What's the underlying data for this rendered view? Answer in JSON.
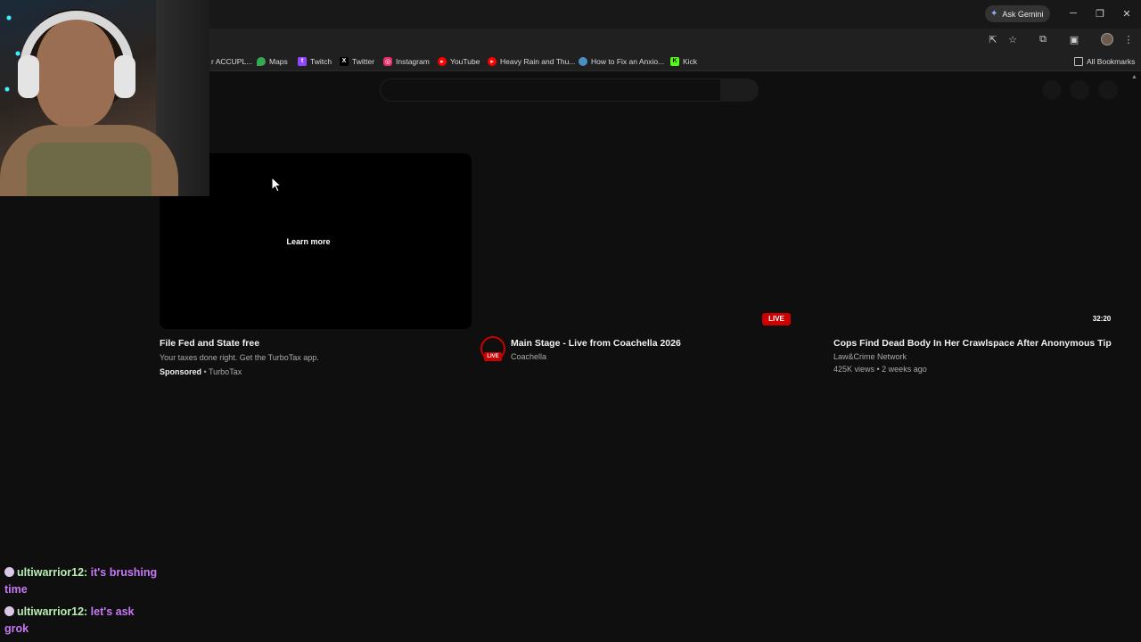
{
  "browser": {
    "ask_gemini": "Ask Gemini",
    "bookmarks": [
      {
        "label": "r ACCUPL...",
        "icon": "partial-icon",
        "color": "#202020"
      },
      {
        "label": "Maps",
        "icon": "maps-icon",
        "color": "#34a853"
      },
      {
        "label": "Twitch",
        "icon": "twitch-icon",
        "color": "#9146ff"
      },
      {
        "label": "Twitter",
        "icon": "x-icon",
        "color": "#000000"
      },
      {
        "label": "Instagram",
        "icon": "instagram-icon",
        "color": "#e1306c"
      },
      {
        "label": "YouTube",
        "icon": "youtube-icon",
        "color": "#ff0000"
      },
      {
        "label": "Heavy Rain and Thu...",
        "icon": "youtube-icon",
        "color": "#ff0000"
      },
      {
        "label": "How to Fix an Anxio...",
        "icon": "site-icon",
        "color": "#4a90c2"
      },
      {
        "label": "Kick",
        "icon": "kick-icon",
        "color": "#53fc18"
      }
    ],
    "all_bookmarks": "All Bookmarks"
  },
  "videos": [
    {
      "title": "File Fed and State free",
      "description": "Your taxes done right. Get the TurboTax app.",
      "sponsored": "Sponsored",
      "advertiser": "TurboTax",
      "overlay": "Learn more"
    },
    {
      "title": "Main Stage - Live from Coachella 2026",
      "channel": "Coachella",
      "badge": "LIVE",
      "avatar_badge": "LIVE"
    },
    {
      "title": "Cops Find Dead Body In Her Crawlspace After Anonymous Tip",
      "channel": "Law&Crime Network",
      "meta": "425K views • 2 weeks ago",
      "duration": "32:20"
    }
  ],
  "chat": [
    {
      "user": "ultiwarrior12:",
      "message": "it's brushing time"
    },
    {
      "user": "ultiwarrior12:",
      "message": "let's ask grok"
    }
  ],
  "colors": {
    "live_red": "#cc0000",
    "chat_user": "#b6f0b0",
    "chat_message": "#c878f5",
    "page_bg": "#0f0f0f"
  }
}
